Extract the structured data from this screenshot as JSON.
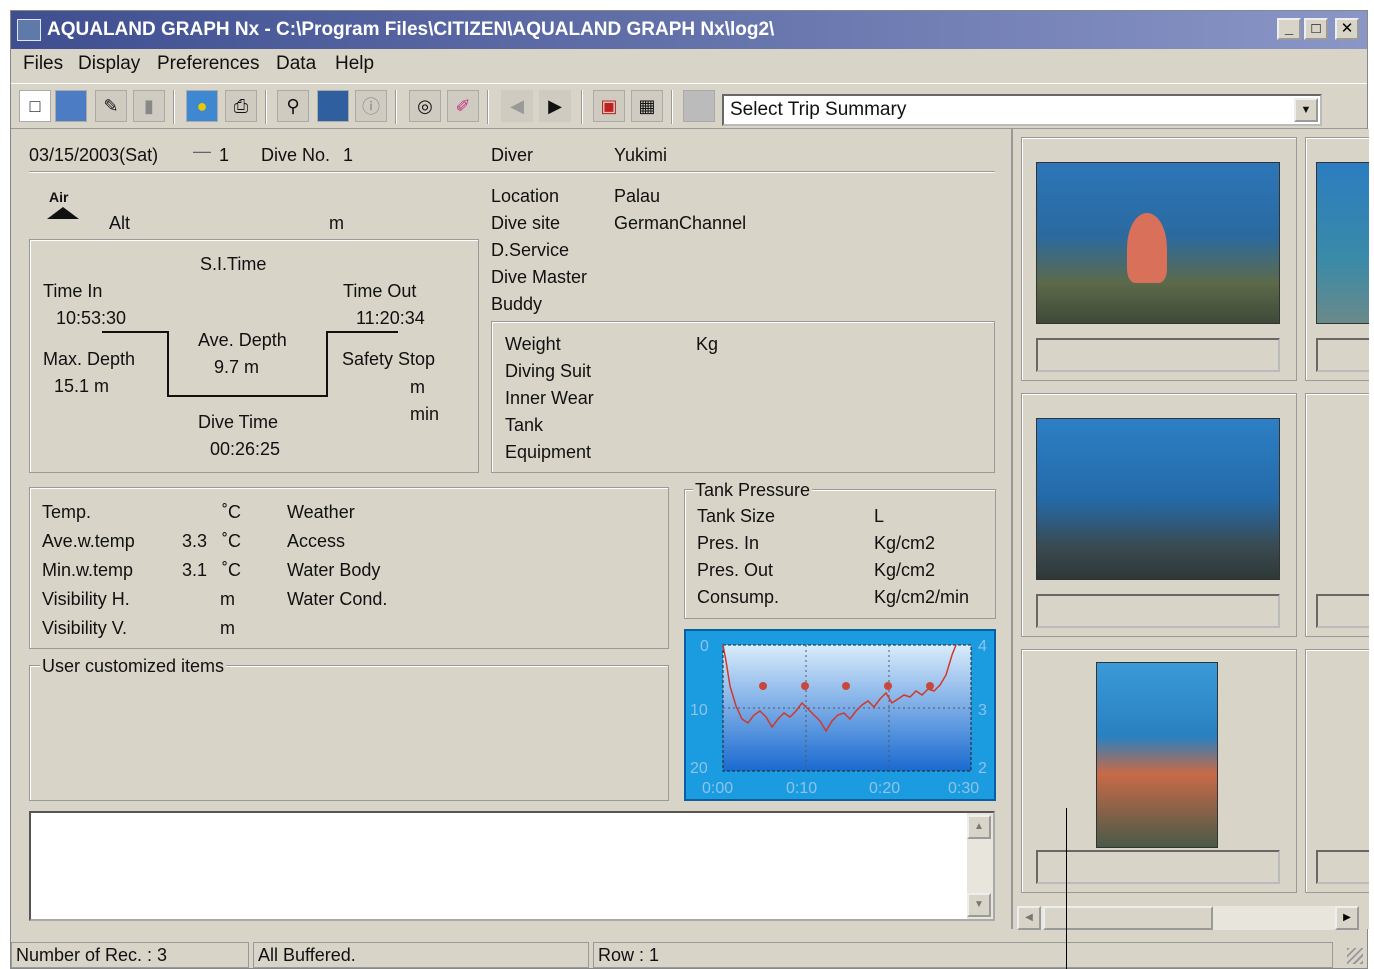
{
  "window": {
    "title": "AQUALAND GRAPH Nx - C:\\Program Files\\CITIZEN\\AQUALAND GRAPH Nx\\log2\\",
    "minimize": "_",
    "maximize": "□",
    "close": "✕"
  },
  "menu": [
    "Files",
    "Display",
    "Preferences",
    "Data",
    "Help"
  ],
  "toolbar": {
    "icons": [
      "new-icon",
      "map-icon",
      "edit-icon",
      "delete-icon",
      "globe-icon",
      "print-icon",
      "binoculars-icon",
      "photo-icon",
      "info-icon",
      "lifebuoy-icon",
      "pen-icon",
      "arrow-left-icon",
      "arrow-right-icon",
      "export-icon",
      "table-icon",
      "blank-icon"
    ],
    "trip_select": "Select Trip Summary"
  },
  "dive": {
    "date": "03/15/2003(Sat)",
    "dash": "—",
    "dive_index": "1",
    "dive_no_label": "Dive No.",
    "dive_no": "1",
    "mode_icon_text": "Air",
    "alt_label": "Alt",
    "alt_unit": "m",
    "si_time_label": "S.I.Time",
    "time_in_label": "Time In",
    "time_in": "10:53:30",
    "time_out_label": "Time Out",
    "time_out": "11:20:34",
    "max_depth_label": "Max. Depth",
    "max_depth": "15.1  m",
    "ave_depth_label": "Ave. Depth",
    "ave_depth": "9.7   m",
    "safety_stop_label": "Safety Stop",
    "safety_stop_m": "m",
    "safety_stop_min": "min",
    "dive_time_label": "Dive Time",
    "dive_time": "00:26:25"
  },
  "info": {
    "diver_label": "Diver",
    "diver": "Yukimi",
    "location_label": "Location",
    "location": "Palau",
    "dive_site_label": "Dive site",
    "dive_site": "GermanChannel",
    "dservice_label": "D.Service",
    "dive_master_label": "Dive Master",
    "buddy_label": "Buddy"
  },
  "gear": {
    "weight_label": "Weight",
    "weight_unit": "Kg",
    "suit_label": "Diving Suit",
    "inner_label": "Inner Wear",
    "tank_label": "Tank",
    "equipment_label": "Equipment"
  },
  "conditions": {
    "temp_label": "Temp.",
    "temp_unit": "˚C",
    "avew_label": "Ave.w.temp",
    "avew_val": "3.3",
    "avew_unit": "˚C",
    "minw_label": "Min.w.temp",
    "minw_val": "3.1",
    "minw_unit": "˚C",
    "vish_label": "Visibility H.",
    "vish_unit": "m",
    "visv_label": "Visibility V.",
    "visv_unit": "m",
    "weather_label": "Weather",
    "access_label": "Access",
    "waterbody_label": "Water Body",
    "watercond_label": "Water Cond."
  },
  "tank": {
    "group_label": "Tank Pressure",
    "size_label": "Tank Size",
    "size_unit": "L",
    "pin_label": "Pres. In",
    "pin_unit": "Kg/cm2",
    "pout_label": "Pres. Out",
    "pout_unit": "Kg/cm2",
    "cons_label": "Consump.",
    "cons_unit": "Kg/cm2/min"
  },
  "user_items_label": "User customized items",
  "graph": {
    "y_left": [
      "0",
      "10",
      "20"
    ],
    "y_right": [
      "4",
      "3",
      "2"
    ],
    "x": [
      "0:00",
      "0:10",
      "0:20",
      "0:30"
    ],
    "colors": {
      "bg": "#1b9ce0",
      "line": "#d2382a",
      "marker": "#c8463a"
    }
  },
  "status": {
    "records": "Number of Rec. : 3",
    "buffer": "All Buffered.",
    "row": "Row : 1"
  }
}
